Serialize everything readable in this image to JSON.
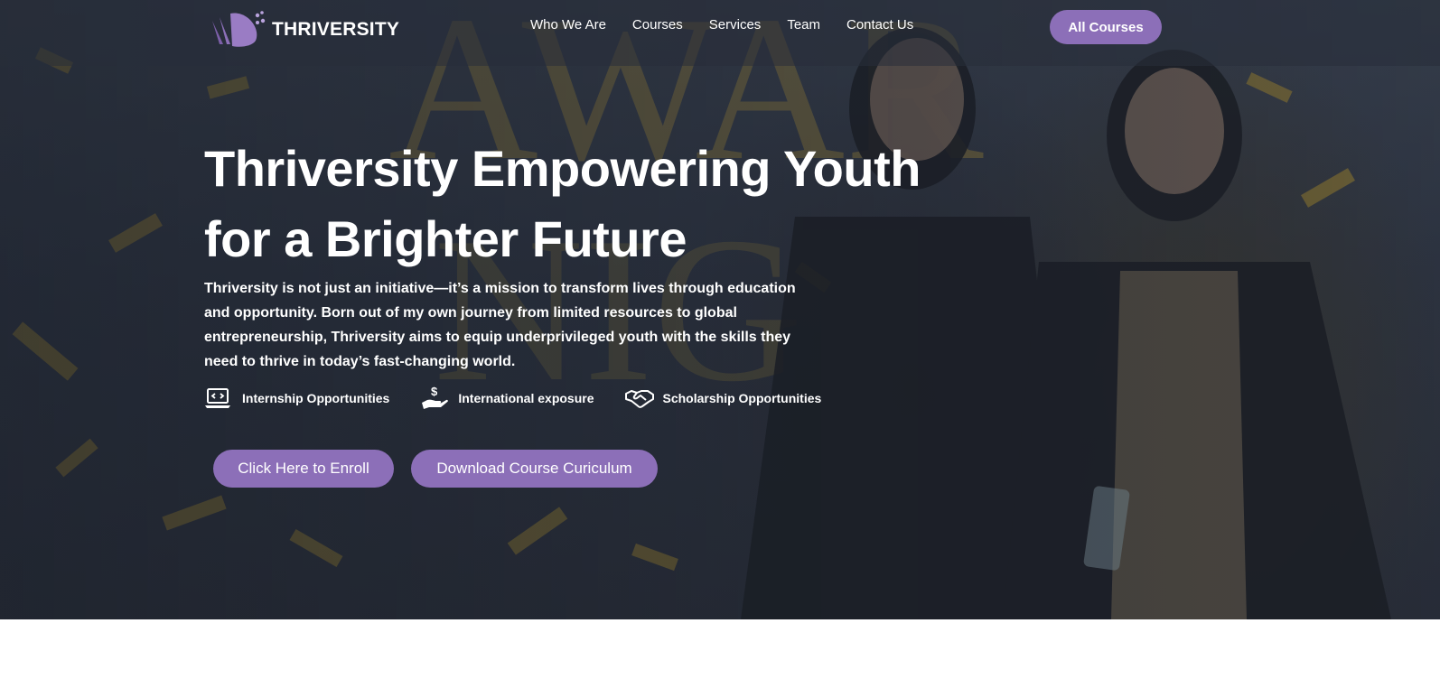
{
  "brand": {
    "name": "THRIVERSITY"
  },
  "nav": {
    "links": [
      "Who We Are",
      "Courses",
      "Services",
      "Team",
      "Contact Us"
    ],
    "cta_label": "All Courses"
  },
  "hero": {
    "headline_line1": "Thriversity Empowering Youth",
    "headline_line2": "for a Brighter Future",
    "description": "Thriversity is not just an initiative—it’s a mission to transform lives through education and opportunity. Born out of my own journey from limited resources to global entrepreneurship, Thriversity aims to equip underprivileged youth with the skills they need to thrive in today’s fast-changing world.",
    "features": [
      {
        "icon": "laptop-code-icon",
        "label": "Internship Opportunities"
      },
      {
        "icon": "hand-dollar-icon",
        "label": "International exposure"
      },
      {
        "icon": "handshake-icon",
        "label": "Scholarship Opportunities"
      }
    ],
    "buttons": {
      "enroll": "Click Here to Enroll",
      "download": "Download Course Curiculum"
    },
    "background_sign_text": "AWARDS NIGHT"
  },
  "colors": {
    "accent": "#8c6fb8",
    "hero_overlay": "#2a303c",
    "text": "#ffffff"
  }
}
